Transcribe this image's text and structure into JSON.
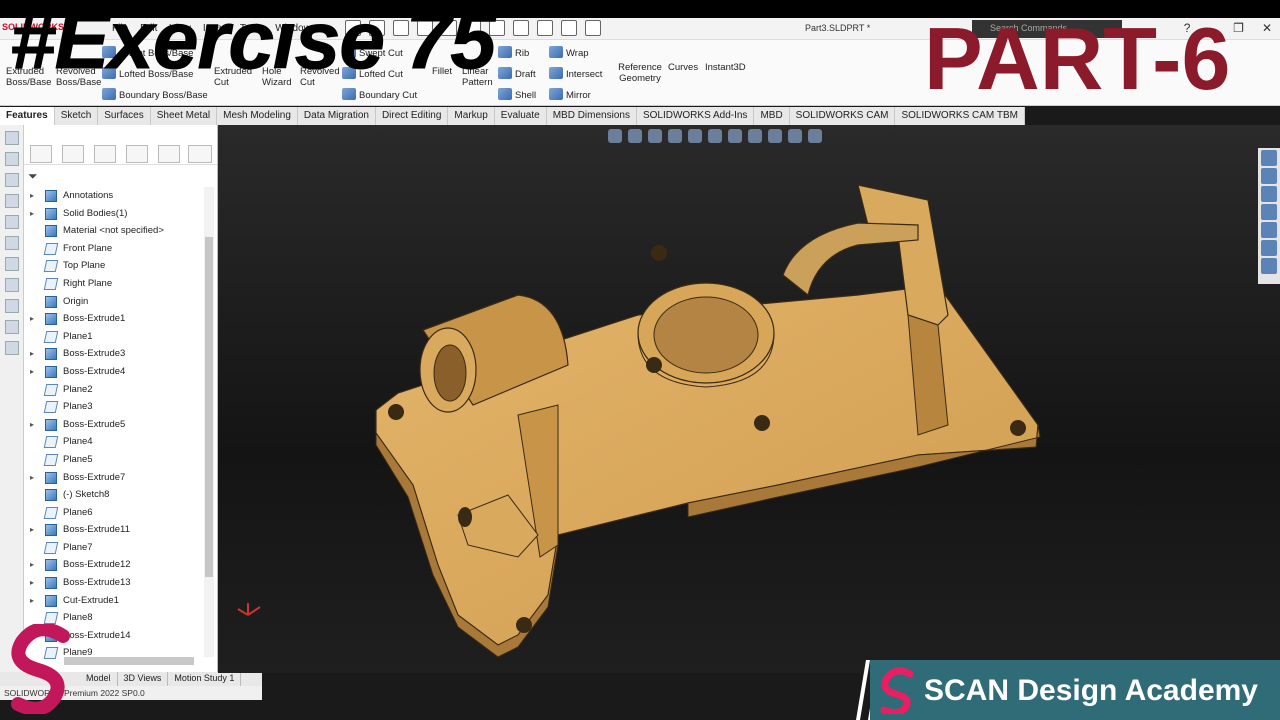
{
  "app": {
    "logo_text": "SOLIDWORKS",
    "document_title": "Part3.SLDPRT *",
    "search_placeholder": "Search Commands",
    "menu": [
      "File",
      "Edit",
      "View",
      "Insert",
      "Tools",
      "Window"
    ]
  },
  "ribbon": {
    "extruded": "Extruded Boss/Base",
    "revolved": "Revolved Boss/Base",
    "swept_boss": "Swept Boss/Base",
    "lofted_boss": "Lofted Boss/Base",
    "boundary_boss": "Boundary Boss/Base",
    "extruded_cut": "Extruded Cut",
    "hole_wizard": "Hole Wizard",
    "revolved_cut": "Revolved Cut",
    "swept_cut": "Swept Cut",
    "lofted_cut": "Lofted Cut",
    "boundary_cut": "Boundary Cut",
    "fillet": "Fillet",
    "linear_pattern": "Linear Pattern",
    "rib": "Rib",
    "draft": "Draft",
    "shell": "Shell",
    "wrap": "Wrap",
    "intersect": "Intersect",
    "mirror": "Mirror",
    "reference_geometry": "Reference Geometry",
    "curves": "Curves",
    "instant3d": "Instant3D"
  },
  "tabs": [
    "Features",
    "Sketch",
    "Surfaces",
    "Sheet Metal",
    "Mesh Modeling",
    "Data Migration",
    "Direct Editing",
    "Markup",
    "Evaluate",
    "MBD Dimensions",
    "SOLIDWORKS Add-Ins",
    "MBD",
    "SOLIDWORKS CAM",
    "SOLIDWORKS CAM TBM"
  ],
  "tree": [
    {
      "label": "Annotations",
      "expand": true,
      "kind": "feature"
    },
    {
      "label": "Solid Bodies(1)",
      "expand": true,
      "kind": "feature"
    },
    {
      "label": "Material <not specified>",
      "expand": false,
      "kind": "feature"
    },
    {
      "label": "Front Plane",
      "expand": false,
      "kind": "plane"
    },
    {
      "label": "Top Plane",
      "expand": false,
      "kind": "plane"
    },
    {
      "label": "Right Plane",
      "expand": false,
      "kind": "plane"
    },
    {
      "label": "Origin",
      "expand": false,
      "kind": "feature"
    },
    {
      "label": "Boss-Extrude1",
      "expand": true,
      "kind": "feature"
    },
    {
      "label": "Plane1",
      "expand": false,
      "kind": "plane"
    },
    {
      "label": "Boss-Extrude3",
      "expand": true,
      "kind": "feature"
    },
    {
      "label": "Boss-Extrude4",
      "expand": true,
      "kind": "feature"
    },
    {
      "label": "Plane2",
      "expand": false,
      "kind": "plane"
    },
    {
      "label": "Plane3",
      "expand": false,
      "kind": "plane"
    },
    {
      "label": "Boss-Extrude5",
      "expand": true,
      "kind": "feature"
    },
    {
      "label": "Plane4",
      "expand": false,
      "kind": "plane"
    },
    {
      "label": "Plane5",
      "expand": false,
      "kind": "plane"
    },
    {
      "label": "Boss-Extrude7",
      "expand": true,
      "kind": "feature"
    },
    {
      "label": "(-) Sketch8",
      "expand": false,
      "kind": "feature"
    },
    {
      "label": "Plane6",
      "expand": false,
      "kind": "plane"
    },
    {
      "label": "Boss-Extrude11",
      "expand": true,
      "kind": "feature"
    },
    {
      "label": "Plane7",
      "expand": false,
      "kind": "plane"
    },
    {
      "label": "Boss-Extrude12",
      "expand": true,
      "kind": "feature"
    },
    {
      "label": "Boss-Extrude13",
      "expand": true,
      "kind": "feature"
    },
    {
      "label": "Cut-Extrude1",
      "expand": true,
      "kind": "feature"
    },
    {
      "label": "Plane8",
      "expand": false,
      "kind": "plane"
    },
    {
      "label": "Boss-Extrude14",
      "expand": true,
      "kind": "feature"
    },
    {
      "label": "Plane9",
      "expand": false,
      "kind": "plane"
    }
  ],
  "bottom_tabs": [
    "Model",
    "3D Views",
    "Motion Study 1"
  ],
  "status": "SOLIDWORKS Premium 2022 SP0.0",
  "overlay": {
    "exercise": "#Exercise 75",
    "part": "PART-6",
    "academy": "SCAN Design Academy"
  },
  "colors": {
    "part_face": "#d9a95e",
    "part_dark": "#a87a38",
    "part_title": "#8b1a2b",
    "academy_bg": "#2f6c78"
  }
}
